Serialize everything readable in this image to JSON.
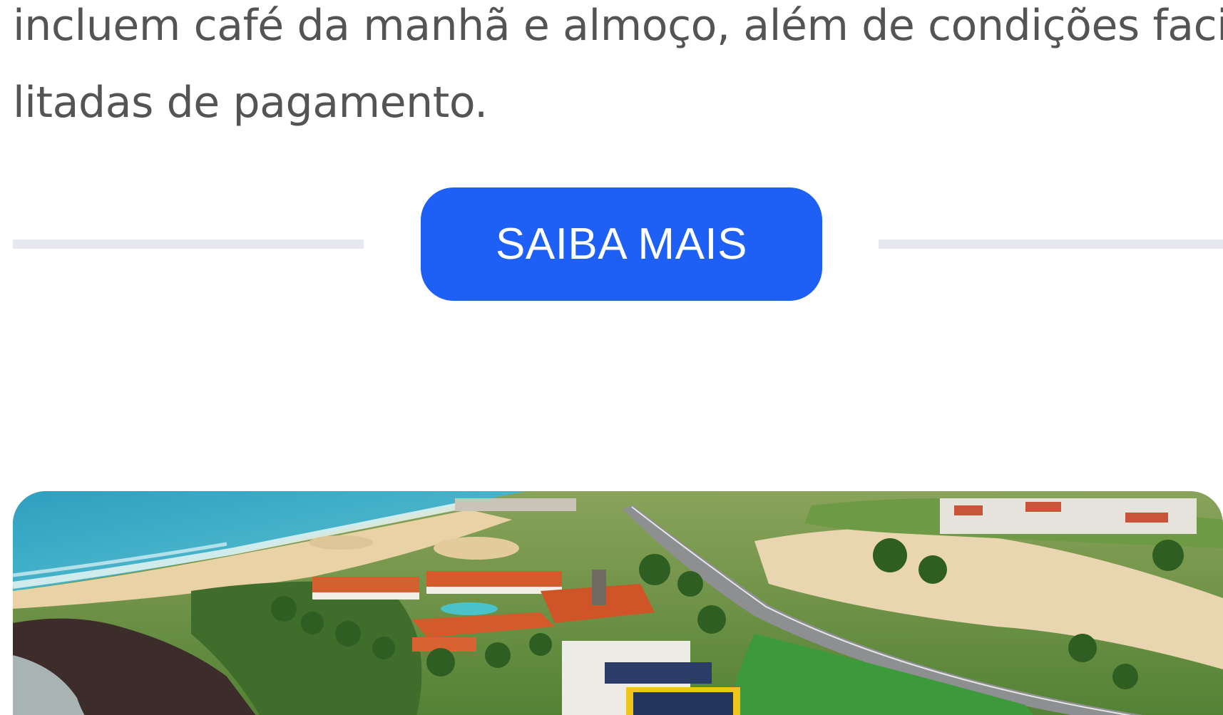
{
  "content": {
    "paragraph_lines": [
      "incluem café da manhã e almoço, além de condições faci-",
      "litadas de pagamento."
    ]
  },
  "cta": {
    "label": "SAIBA MAIS",
    "color": "#1e5ff5"
  },
  "colors": {
    "text": "#545454",
    "divider": "#e6e7ef",
    "background": "#ffffff"
  },
  "photo": {
    "subject": "aerial-resort-beach-photo"
  }
}
